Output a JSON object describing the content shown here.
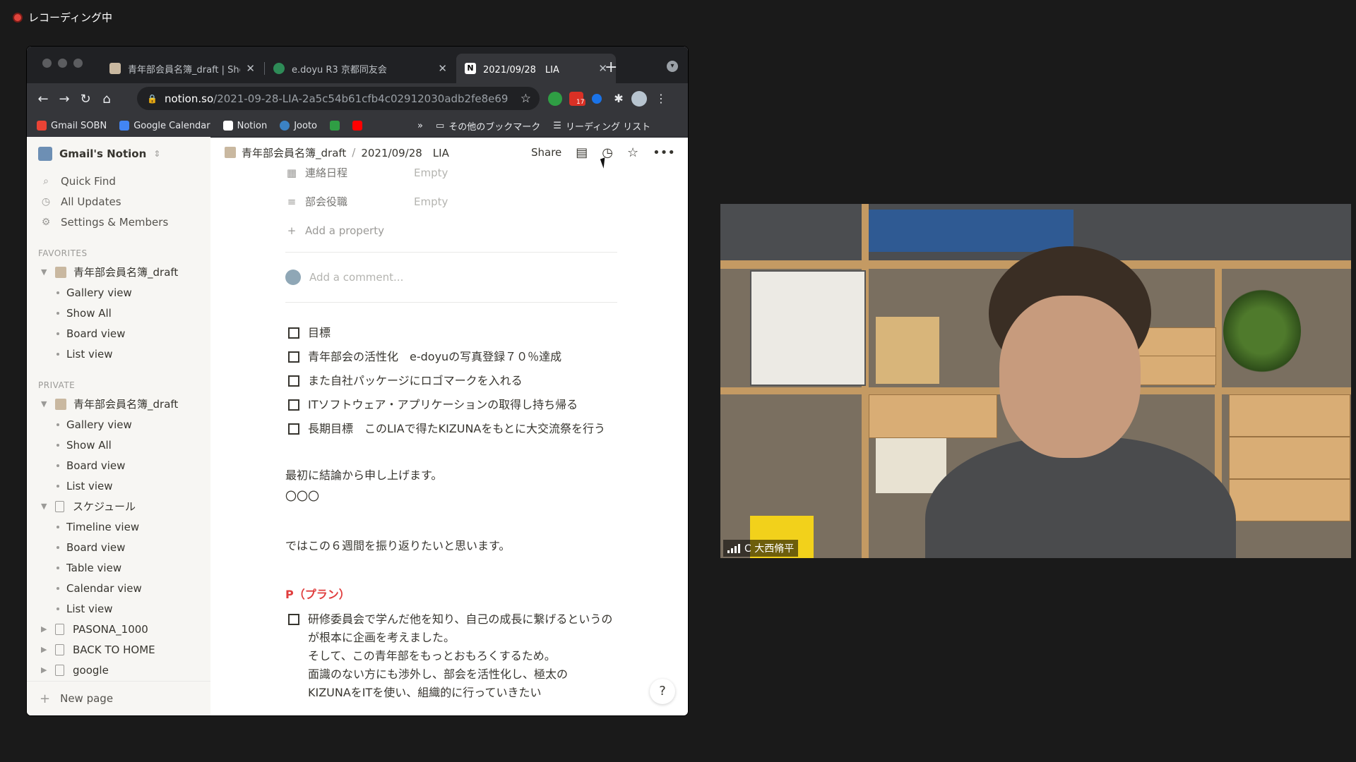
{
  "recording": {
    "label": "レコーディング中"
  },
  "browser": {
    "tabs": [
      {
        "title": "青年部会員名簿_draft | Show",
        "favicon_color": "#c9b8a0"
      },
      {
        "title": "e.doyu R3 京都同友会",
        "favicon_color": "#2e8b57"
      },
      {
        "title": "2021/09/28　LIA",
        "favicon_color": "#ffffff"
      }
    ],
    "new_tab_icon": "plus-icon",
    "url": {
      "host": "notion.so",
      "path": "/2021-09-28-LIA-2a5c54b61cfb4c02912030adb2fe8e69"
    },
    "extension_badge": "17",
    "bookmarks": [
      {
        "label": "Gmail SOBN",
        "color": "#ea4335"
      },
      {
        "label": "Google Calendar",
        "color": "#4285f4"
      },
      {
        "label": "Notion",
        "color": "#ffffff"
      },
      {
        "label": "Jooto",
        "color": "#3b82c4"
      }
    ],
    "bookmarks_more": "»",
    "other_bookmarks": "その他のブックマーク",
    "reading_list": "リーディング リスト"
  },
  "sidebar": {
    "workspace": "Gmail's Notion",
    "nav": [
      {
        "label": "Quick Find",
        "icon": "search-icon"
      },
      {
        "label": "All Updates",
        "icon": "clock-icon"
      },
      {
        "label": "Settings & Members",
        "icon": "gear-icon"
      }
    ],
    "favorites_header": "FAVORITES",
    "favorites": {
      "title": "青年部会員名簿_draft",
      "views": [
        "Gallery view",
        "Show All",
        "Board view",
        "List view"
      ]
    },
    "private_header": "PRIVATE",
    "private": {
      "title": "青年部会員名簿_draft",
      "views": [
        "Gallery view",
        "Show All",
        "Board view",
        "List view"
      ]
    },
    "schedule": {
      "title": "スケジュール",
      "views": [
        "Timeline view",
        "Board view",
        "Table view",
        "Calendar view",
        "List view"
      ]
    },
    "pages": [
      "PASONA_1000",
      "BACK TO HOME",
      "google"
    ],
    "new_page": "New page"
  },
  "topbar": {
    "crumbs": [
      "青年部会員名簿_draft",
      "2021/09/28　LIA"
    ],
    "share": "Share"
  },
  "page": {
    "properties": [
      {
        "name": "連絡日程",
        "value": "Empty",
        "icon": "calendar-icon"
      },
      {
        "name": "部会役職",
        "value": "Empty",
        "icon": "text-icon"
      }
    ],
    "add_property": "Add a property",
    "add_comment": "Add a comment...",
    "todos": [
      "目標",
      "青年部会の活性化　e-doyuの写真登録７０％達成",
      "また自社パッケージにロゴマークを入れる",
      "ITソフトウェア・アプリケーションの取得し持ち帰る",
      "長期目標　このLIAで得たKIZUNAをもとに大交流祭を行う"
    ],
    "para1": "最初に結論から申し上げます。",
    "para2": "〇〇〇",
    "para3": "ではこの６週間を振り返りたいと思います。",
    "plan_title": "P（プラン）",
    "plan_todo": "研修委員会で学んだ他を知り、自己の成長に繋げるというのが根本に企画を考えました。",
    "plan_line2": "そして、この青年部をもっとおもろくするため。",
    "plan_line3": "面識のない方にも渉外し、部会を活性化し、極太の",
    "plan_line4": "KIZUNAをITを使い、組織的に行っていきたい",
    "help": "?"
  },
  "video": {
    "participant": "C 大西脩平"
  }
}
